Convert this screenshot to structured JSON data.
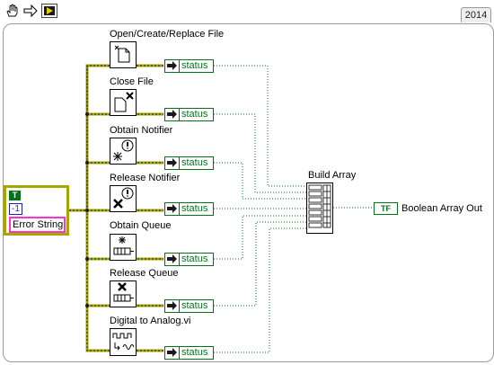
{
  "toolbar": {
    "icons": [
      "hand-icon",
      "arrow-icon",
      "run-icon"
    ],
    "version": "2014"
  },
  "cluster_constant": {
    "boolean_value": "T",
    "numeric_value": "-1",
    "string_value": "Error String"
  },
  "functions": [
    {
      "label": "Open/Create/Replace File",
      "icon": "open-file-icon",
      "indicator": "status"
    },
    {
      "label": "Close File",
      "icon": "close-file-icon",
      "indicator": "status"
    },
    {
      "label": "Obtain Notifier",
      "icon": "obtain-notifier-icon",
      "indicator": "status"
    },
    {
      "label": "Release Notifier",
      "icon": "release-notifier-icon",
      "indicator": "status"
    },
    {
      "label": "Obtain Queue",
      "icon": "obtain-queue-icon",
      "indicator": "status"
    },
    {
      "label": "Release Queue",
      "icon": "release-queue-icon",
      "indicator": "status"
    },
    {
      "label": "Digital to Analog.vi",
      "icon": "digital-to-analog-icon",
      "indicator": "status"
    }
  ],
  "build_array": {
    "label": "Build Array"
  },
  "output": {
    "terminal_text": "TF",
    "label": "Boolean Array Out"
  },
  "colors": {
    "cluster_wire": "#a6a600",
    "boolean_wire": "#00731b",
    "numeric": "#1f1fbe",
    "string": "#ff33cc"
  }
}
